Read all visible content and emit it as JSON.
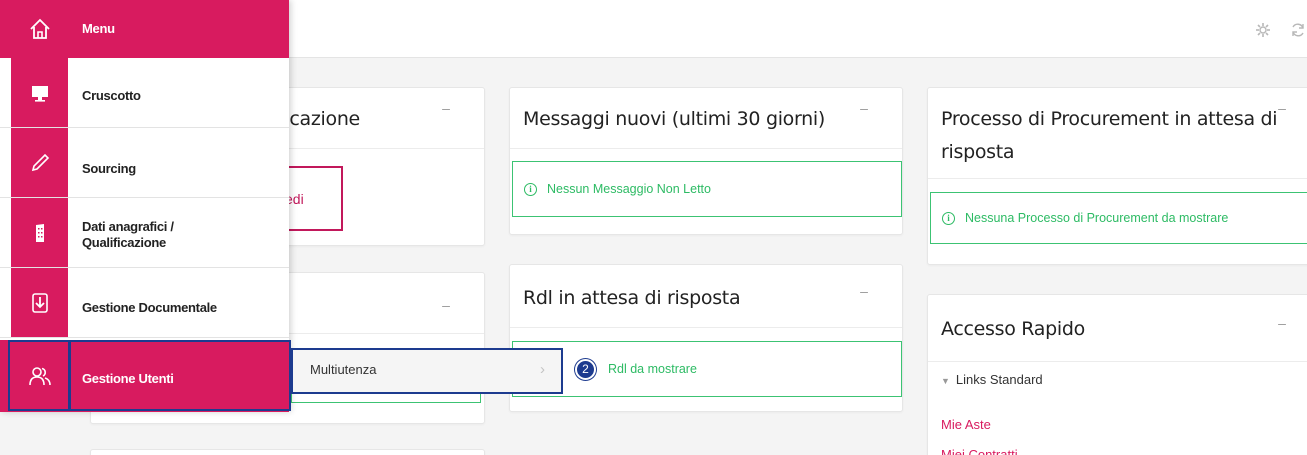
{
  "menu": {
    "header_label": "Menu",
    "items": [
      {
        "label": "Cruscotto",
        "icon": "monitor-icon"
      },
      {
        "label": "Sourcing",
        "icon": "pencil-icon"
      },
      {
        "label": "Dati anagrafici /",
        "label2": "Qualificazione",
        "icon": "building-icon"
      },
      {
        "label": "Gestione Documentale",
        "icon": "document-download-icon"
      },
      {
        "label": "Gestione Utenti",
        "icon": "users-icon",
        "active": true
      }
    ],
    "submenu": {
      "label": "Multiutenza",
      "chevron": "›"
    },
    "badge": "2"
  },
  "cards": {
    "qualifica": {
      "title": "ificazione",
      "button_text": "edi",
      "minimize": "–"
    },
    "messages": {
      "title": "Messaggi nuovi (ultimi 30 giorni)",
      "minimize": "–",
      "notice": "Nessun Messaggio Non Letto"
    },
    "procurement": {
      "title_line1": "Processo di Procurement in attesa di",
      "title_line2": "risposta",
      "minimize": "–",
      "notice": "Nessuna Processo di Procurement da mostrare"
    },
    "rdl": {
      "title": "Rdl in attesa di risposta",
      "minimize": "–",
      "notice": "Rdl da mostrare"
    },
    "left_lower": {
      "minimize": "–"
    },
    "quick": {
      "title": "Accesso Rapido",
      "minimize": "–",
      "group": "Links Standard",
      "links": [
        "Mie Aste",
        "Miei Contratti"
      ]
    }
  },
  "topbar": {
    "icons": [
      "gear-icon",
      "refresh-icon"
    ]
  },
  "colors": {
    "brand": "#d81b5f",
    "success": "#2dbb64",
    "highlight": "#1d3b8f"
  }
}
